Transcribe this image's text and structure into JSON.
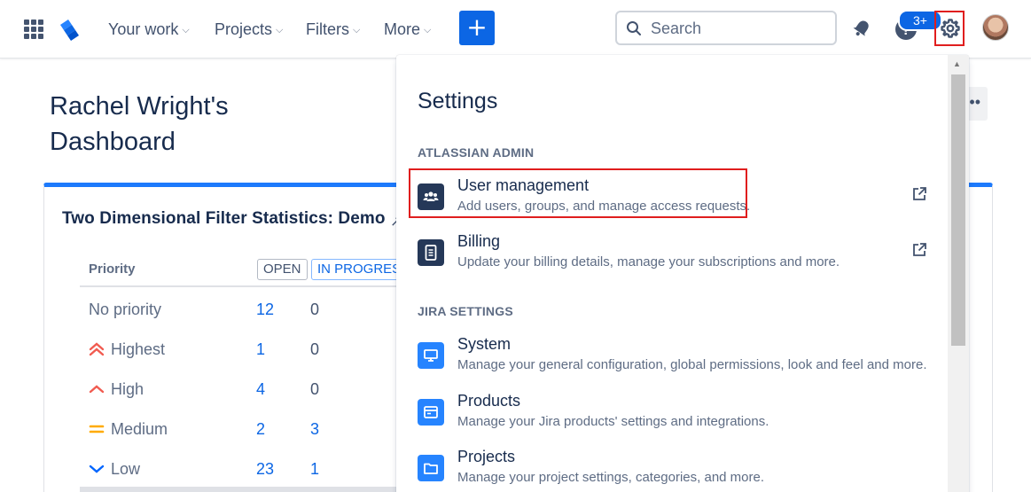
{
  "nav": {
    "your_work": "Your work",
    "projects": "Projects",
    "filters": "Filters",
    "more": "More",
    "create_label": "+",
    "search_placeholder": "Search",
    "help_badge": "3+",
    "accent_color": "#0c66e4"
  },
  "dashboard": {
    "title": "Rachel Wright's Dashboard",
    "more_label": "••",
    "gadget": {
      "title": "Two Dimensional Filter Statistics: Demo",
      "title_extra": "↗",
      "header_priority": "Priority",
      "status_columns": [
        "OPEN",
        "IN PROGRESS"
      ],
      "rows": [
        {
          "priority": "No priority",
          "icon": "",
          "icon_color": "#5e6c84",
          "open": "12",
          "in_progress": "0"
        },
        {
          "priority": "Highest",
          "icon": "highest-priority-icon",
          "icon_color": "#f15b50",
          "open": "1",
          "in_progress": "0"
        },
        {
          "priority": "High",
          "icon": "high-priority-icon",
          "icon_color": "#f15b50",
          "open": "4",
          "in_progress": "0"
        },
        {
          "priority": "Medium",
          "icon": "medium-priority-icon",
          "icon_color": "#ffab00",
          "open": "2",
          "in_progress": "3"
        },
        {
          "priority": "Low",
          "icon": "low-priority-icon",
          "icon_color": "#0065ff",
          "open": "23",
          "in_progress": "1"
        }
      ]
    }
  },
  "settings_menu": {
    "title": "Settings",
    "sections": [
      {
        "heading": "ATLASSIAN ADMIN",
        "items": [
          {
            "title": "User management",
            "description": "Add users, groups, and manage access requests.",
            "icon": "people-icon",
            "external": true
          },
          {
            "title": "Billing",
            "description": "Update your billing details, manage your subscriptions and more.",
            "icon": "receipt-icon",
            "external": true
          }
        ]
      },
      {
        "heading": "JIRA SETTINGS",
        "items": [
          {
            "title": "System",
            "description": "Manage your general configuration, global permissions, look and feel and more.",
            "icon": "monitor-icon",
            "external": false
          },
          {
            "title": "Products",
            "description": "Manage your Jira products' settings and integrations.",
            "icon": "window-icon",
            "external": false
          },
          {
            "title": "Projects",
            "description": "Manage your project settings, categories, and more.",
            "icon": "folder-icon",
            "external": false
          }
        ]
      }
    ]
  }
}
